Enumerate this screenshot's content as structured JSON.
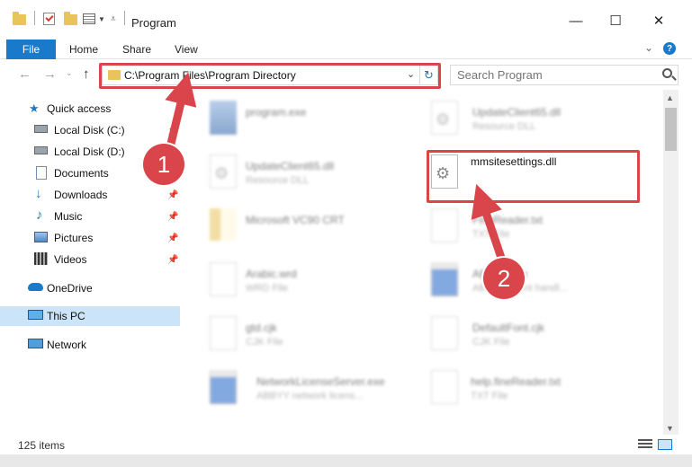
{
  "window": {
    "title": "Program",
    "minimize": "—",
    "maximize": "☐",
    "close": "✕"
  },
  "ribbon": {
    "tabs": [
      "File",
      "Home",
      "Share",
      "View"
    ],
    "help": "?"
  },
  "address": {
    "path": "C:\\Program Files\\Program Directory",
    "refresh": "↻"
  },
  "search": {
    "placeholder": "Search Program"
  },
  "sidebar": {
    "items": [
      {
        "label": "Quick access",
        "icon": "star-icon"
      },
      {
        "label": "Local Disk (C:)",
        "icon": "drive-icon",
        "pinned": true
      },
      {
        "label": "Local Disk (D:)",
        "icon": "drive-icon"
      },
      {
        "label": "Documents",
        "icon": "documents-icon",
        "pinned": true
      },
      {
        "label": "Downloads",
        "icon": "download-icon",
        "pinned": true
      },
      {
        "label": "Music",
        "icon": "music-icon",
        "pinned": true
      },
      {
        "label": "Pictures",
        "icon": "pictures-icon",
        "pinned": true
      },
      {
        "label": "Videos",
        "icon": "videos-icon",
        "pinned": true
      },
      {
        "label": "OneDrive",
        "icon": "cloud-icon"
      },
      {
        "label": "This PC",
        "icon": "computer-icon",
        "selected": true
      },
      {
        "label": "Network",
        "icon": "network-icon"
      }
    ]
  },
  "files": [
    {
      "name": "program.exe",
      "type": "",
      "icon": "setup",
      "highlight": false
    },
    {
      "name": "UpdateClient65.dll",
      "type": "Resource DLL",
      "icon": "gear",
      "highlight": false
    },
    {
      "name": "UpdateClient65.dll",
      "type": "Resource DLL",
      "icon": "gear",
      "highlight": false
    },
    {
      "name": "mmsitesettings.dll",
      "type": "",
      "icon": "gear",
      "highlight": true
    },
    {
      "name": "Microsoft VC90 CRT",
      "type": "",
      "icon": "folder",
      "highlight": false
    },
    {
      "name": "FineReader.txt",
      "type": "TXT File",
      "icon": "doc",
      "highlight": false
    },
    {
      "name": "Arabic.wrd",
      "type": "WRD File",
      "icon": "doc",
      "highlight": false
    },
    {
      "name": "ABBYY.exe",
      "type": "ABBYY event handl...",
      "icon": "exe",
      "highlight": false
    },
    {
      "name": "gtd.cjk",
      "type": "CJK File",
      "icon": "doc",
      "highlight": false
    },
    {
      "name": "DefaultFont.cjk",
      "type": "CJK File",
      "icon": "doc",
      "highlight": false
    },
    {
      "name": "NetworkLicenseServer.exe",
      "type": "ABBYY network licens...",
      "icon": "exe",
      "highlight": false
    },
    {
      "name": "help.fineReader.txt",
      "type": "TXT File",
      "icon": "doc",
      "highlight": false
    }
  ],
  "status": {
    "count": "125 items"
  },
  "annotations": {
    "step1": "1",
    "step2": "2"
  },
  "colors": {
    "accent": "#1979ca",
    "highlight": "#d9454a",
    "selected": "#cce4f7"
  }
}
